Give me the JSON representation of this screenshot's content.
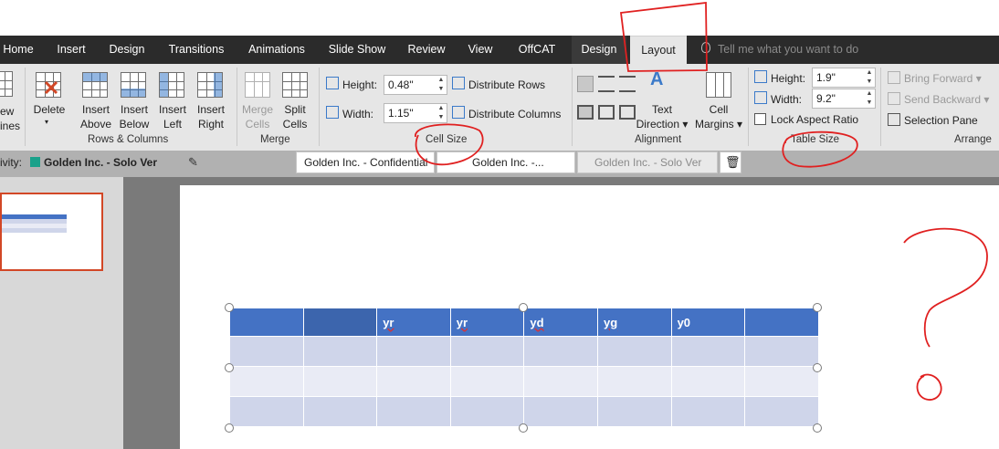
{
  "ribbon_tabs": [
    "Home",
    "Insert",
    "Design",
    "Transitions",
    "Animations",
    "Slide Show",
    "Review",
    "View",
    "OffCAT",
    "Design",
    "Layout"
  ],
  "active_tab": "Layout",
  "tell_me": "Tell me what you want to do",
  "partial_button": {
    "line1": "ew",
    "line2": "ines"
  },
  "rows_columns": {
    "label": "Rows & Columns",
    "delete": "Delete",
    "insert_above": [
      "Insert",
      "Above"
    ],
    "insert_below": [
      "Insert",
      "Below"
    ],
    "insert_left": [
      "Insert",
      "Left"
    ],
    "insert_right": [
      "Insert",
      "Right"
    ]
  },
  "merge": {
    "label": "Merge",
    "merge_cells": [
      "Merge",
      "Cells"
    ],
    "split_cells": [
      "Split",
      "Cells"
    ]
  },
  "cell_size": {
    "label": "Cell Size",
    "height_label": "Height:",
    "height_value": "0.48\"",
    "width_label": "Width:",
    "width_value": "1.15\"",
    "distribute_rows": "Distribute Rows",
    "distribute_columns": "Distribute Columns"
  },
  "alignment": {
    "label": "Alignment",
    "text_direction": [
      "Text",
      "Direction"
    ],
    "cell_margins": [
      "Cell",
      "Margins"
    ]
  },
  "table_size": {
    "label": "Table Size",
    "height_label": "Height:",
    "height_value": "1.9\"",
    "width_label": "Width:",
    "width_value": "9.2\"",
    "lock_aspect": "Lock Aspect Ratio"
  },
  "arrange": {
    "label": "Arrange",
    "bring_forward": "Bring Forward",
    "send_backward": "Send Backward",
    "selection_pane": "Selection Pane"
  },
  "classification_bar": {
    "prefix": "ivity:",
    "current": "Golden Inc. - Solo Ver",
    "box1": "Golden Inc. - Confidential",
    "box2": "Golden Inc. -...",
    "box3": "Golden Inc. - Solo Ver"
  },
  "table": {
    "header": [
      "",
      "",
      "yr",
      "yr",
      "yd",
      "yg",
      "y0",
      ""
    ],
    "rows": [
      [
        "",
        "",
        "",
        "",
        "",
        "",
        "",
        ""
      ],
      [
        "",
        "",
        "",
        "",
        "",
        "",
        "",
        ""
      ],
      [
        "",
        "",
        "",
        "",
        "",
        "",
        "",
        ""
      ]
    ]
  },
  "colors": {
    "header": "#4472c4",
    "band1": "#cfd5ea",
    "band2": "#e9ebf5",
    "annotation": "#e02020",
    "tabbar": "#2b2b2b"
  }
}
